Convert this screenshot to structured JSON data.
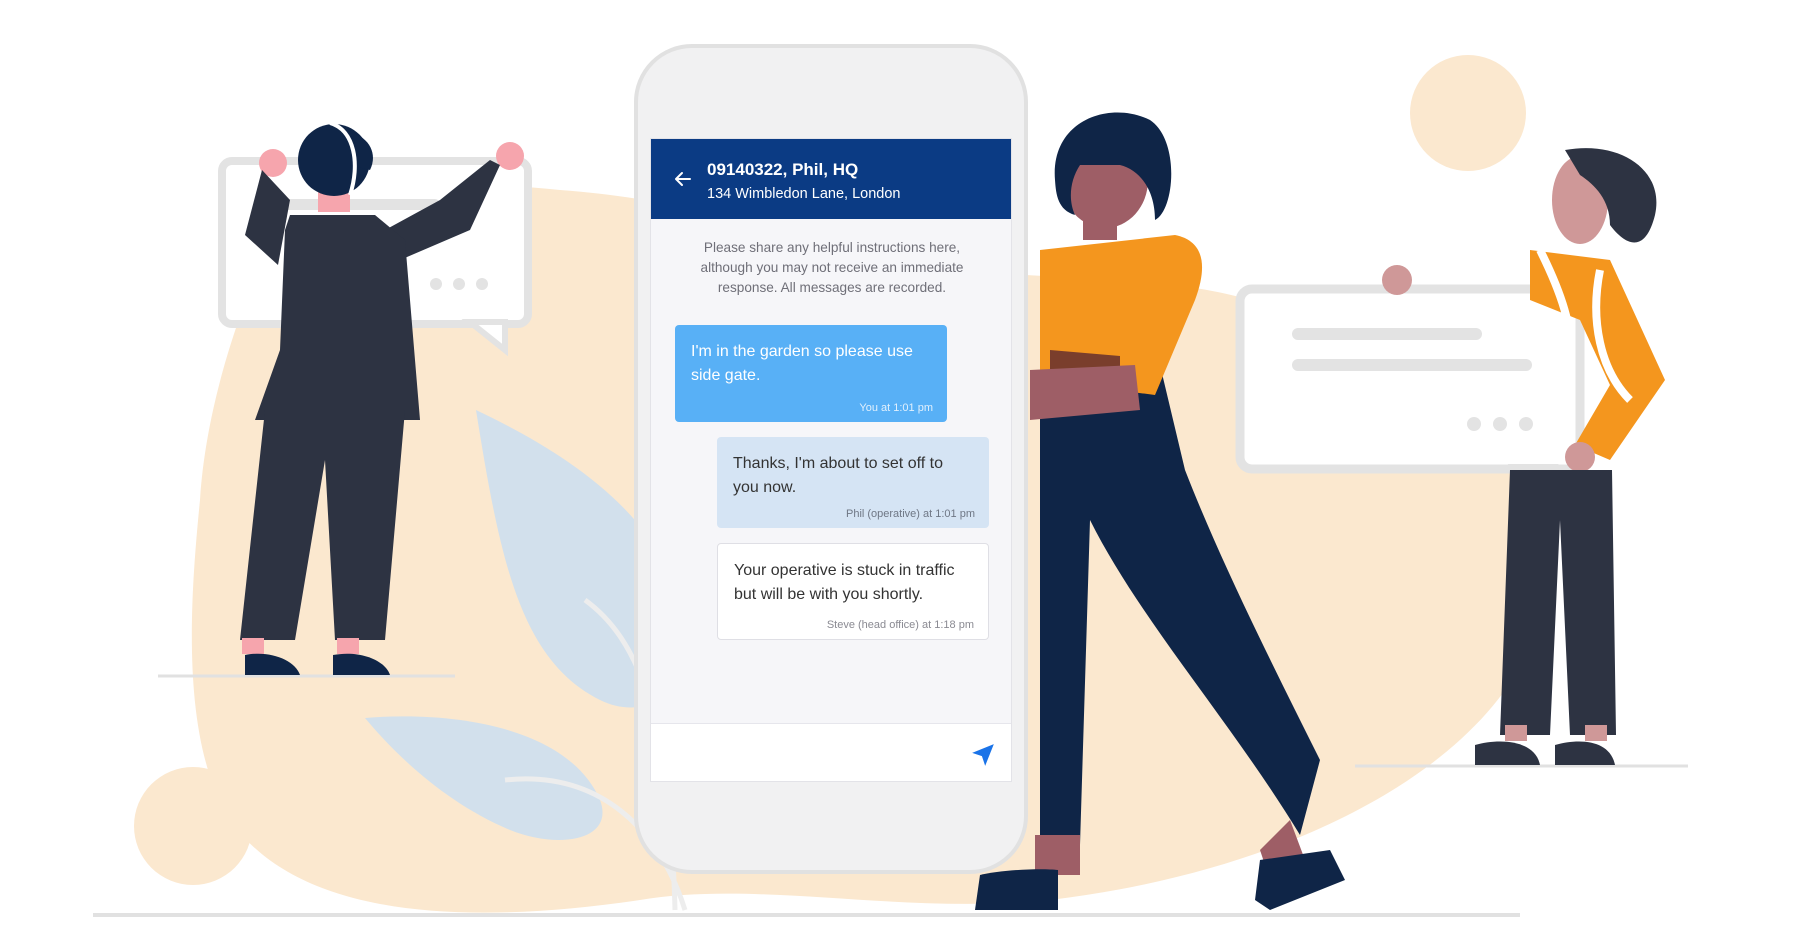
{
  "colors": {
    "header_bg": "#0b3b84",
    "customer_bubble": "#58b0f6",
    "operative_bubble": "#d5e4f4",
    "office_bubble": "#ffffff",
    "send_icon": "#1a73e8",
    "blob": "#fbe8cf",
    "leaf": "#d2e0ec",
    "navy": "#0f2547",
    "orange": "#f4961e"
  },
  "chat": {
    "header": {
      "back_icon": "arrow-left-icon",
      "title": "09140322, Phil, HQ",
      "subtitle": "134 Wimbledon Lane, London"
    },
    "notice": "Please share any helpful instructions here, although you may not receive an immediate response. All messages are recorded.",
    "messages": [
      {
        "text": "I'm in the garden so please use side gate.",
        "meta": "You at 1:01 pm"
      },
      {
        "text": "Thanks, I'm about to set off to you now.",
        "meta": "Phil (operative) at 1:01 pm"
      },
      {
        "text": "Your operative is stuck in traffic but will be with you shortly.",
        "meta": "Steve (head office) at 1:18 pm"
      }
    ],
    "composer": {
      "value": "",
      "send_icon": "send-icon"
    }
  }
}
